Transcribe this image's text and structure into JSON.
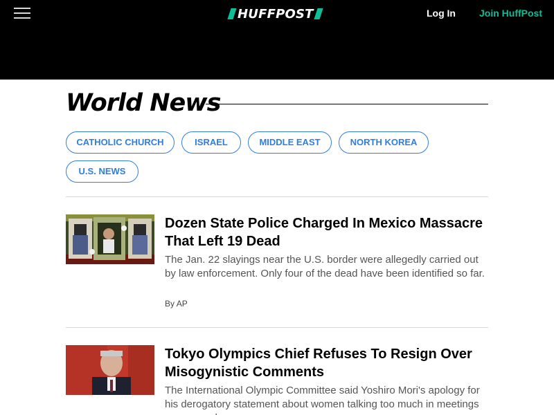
{
  "header": {
    "logo_text": "HUFFPOST",
    "login_label": "Log In",
    "join_label": "Join HuffPost",
    "accent_color": "#0dbe98"
  },
  "section": {
    "title": "World News"
  },
  "tags": [
    {
      "label": "CATHOLIC CHURCH"
    },
    {
      "label": "ISRAEL"
    },
    {
      "label": "MIDDLE EAST"
    },
    {
      "label": "NORTH KOREA"
    },
    {
      "label": "U.S. NEWS"
    }
  ],
  "tag_color": "#2e7de1",
  "articles": [
    {
      "headline": "Dozen State Police Charged In Mexico Massacre That Left 19 Dead",
      "description": "The Jan. 22 slayings near the U.S. border were allegedly carried out by law enforcement. Only four of the dead have been identified so far.",
      "byline_prefix": "By",
      "author": "AP",
      "image": "photo-memorial-portraits"
    },
    {
      "headline": "Tokyo Olympics Chief Refuses To Resign Over Misogynistic Comments",
      "description": "The International Olympic Committee said Yoshiro Mori's apology for his derogatory statement about women talking too much in meetings was enough.",
      "image": "photo-man-speaking"
    }
  ]
}
